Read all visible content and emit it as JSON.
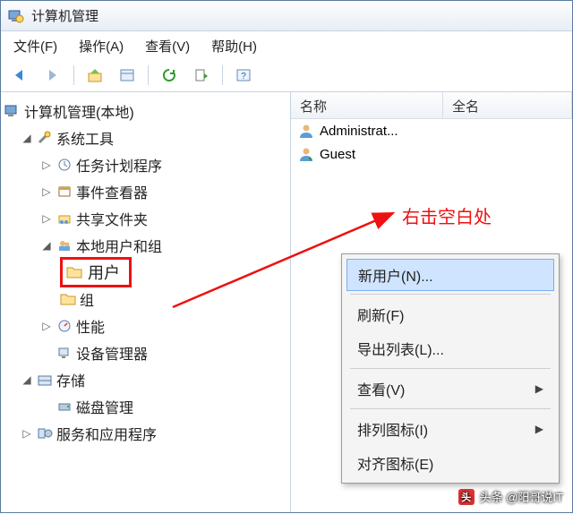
{
  "window": {
    "title": "计算机管理"
  },
  "menu": {
    "file": "文件(F)",
    "action": "操作(A)",
    "view": "查看(V)",
    "help": "帮助(H)"
  },
  "tree": {
    "root": "计算机管理(本地)",
    "sys_tools": "系统工具",
    "task_sched": "任务计划程序",
    "event_viewer": "事件查看器",
    "shared_folders": "共享文件夹",
    "local_users": "本地用户和组",
    "users": "用户",
    "groups": "组",
    "performance": "性能",
    "device_mgr": "设备管理器",
    "storage": "存储",
    "disk_mgmt": "磁盘管理",
    "services_apps": "服务和应用程序"
  },
  "list": {
    "col_name": "名称",
    "col_fullname": "全名",
    "rows": [
      {
        "name": "Administrat..."
      },
      {
        "name": "Guest"
      }
    ]
  },
  "context_menu": {
    "new_user": "新用户(N)...",
    "refresh": "刷新(F)",
    "export_list": "导出列表(L)...",
    "view": "查看(V)",
    "arrange_icons": "排列图标(I)",
    "align_icons": "对齐图标(E)"
  },
  "annotation": {
    "hint": "右击空白处"
  },
  "watermark": {
    "text": "头条 @阳哥说IT"
  }
}
